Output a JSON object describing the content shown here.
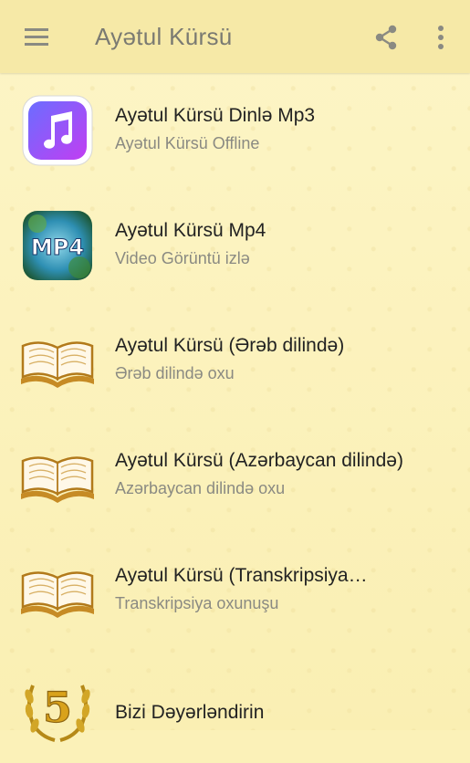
{
  "appbar": {
    "title": "Ayətul Kürsü",
    "menu_icon": "hamburger-menu-icon",
    "share_icon": "share-icon",
    "more_icon": "more-vert-icon"
  },
  "list": {
    "items": [
      {
        "icon": "music-note-icon",
        "title": "Ayətul Kürsü Dinlə Mp3",
        "subtitle": "Ayətul Kürsü Offline"
      },
      {
        "icon": "mp4-video-icon",
        "title": "Ayətul Kürsü Mp4",
        "subtitle": "Video Görüntü izlə"
      },
      {
        "icon": "open-book-icon",
        "title": "Ayətul Kürsü (Ərəb dilində)",
        "subtitle": "Ərəb dilində oxu"
      },
      {
        "icon": "open-book-icon",
        "title": "Ayətul Kürsü (Azərbaycan dilində)",
        "subtitle": "Azərbaycan dilində oxu"
      },
      {
        "icon": "open-book-icon",
        "title": "Ayətul Kürsü (Transkripsiya…",
        "subtitle": "Transkripsiya oxunuşu"
      },
      {
        "icon": "five-star-laurel-icon",
        "title": "Bizi Dəyərləndirin"
      }
    ]
  }
}
